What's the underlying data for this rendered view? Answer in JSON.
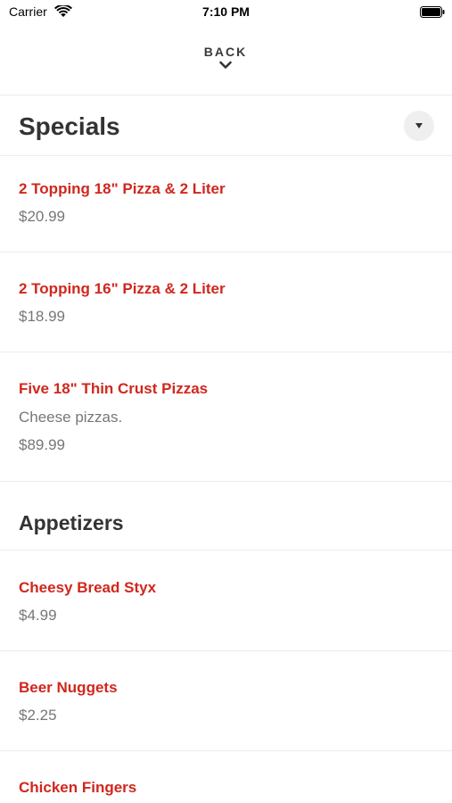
{
  "status_bar": {
    "carrier": "Carrier",
    "time": "7:10 PM"
  },
  "nav": {
    "back_label": "BACK"
  },
  "colors": {
    "accent": "#d0271d",
    "text_dark": "#333333",
    "text_muted": "#777777"
  },
  "sections": [
    {
      "title": "Specials",
      "items": [
        {
          "name": "2 Topping 18\" Pizza & 2 Liter",
          "price": "$20.99"
        },
        {
          "name": "2 Topping 16\" Pizza & 2 Liter",
          "price": "$18.99"
        },
        {
          "name": "Five 18\" Thin Crust Pizzas",
          "description": "Cheese pizzas.",
          "price": "$89.99"
        }
      ]
    },
    {
      "title": "Appetizers",
      "items": [
        {
          "name": "Cheesy Bread Styx",
          "price": "$4.99"
        },
        {
          "name": "Beer Nuggets",
          "price": "$2.25"
        },
        {
          "name": "Chicken Fingers"
        }
      ]
    }
  ]
}
